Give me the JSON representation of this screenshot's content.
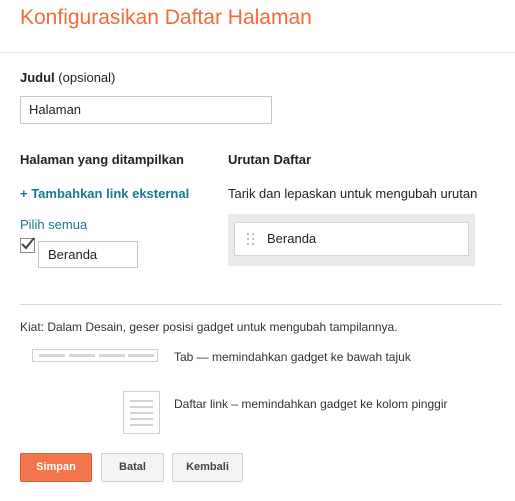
{
  "header": {
    "title": "Konfigurasikan Daftar Halaman"
  },
  "title_field": {
    "label": "Judul",
    "optional_note": "(opsional)",
    "value": "Halaman"
  },
  "pages_section": {
    "heading": "Halaman yang ditampilkan",
    "add_link": "+ Tambahkan link eksternal",
    "select_all": "Pilih semua",
    "pages": [
      {
        "label": "Beranda",
        "checked": true
      }
    ]
  },
  "order_section": {
    "heading": "Urutan Daftar",
    "description": "Tarik dan lepaskan untuk mengubah urutan",
    "items": [
      {
        "label": "Beranda",
        "icon": "drag-handle-icon"
      }
    ]
  },
  "tips": {
    "text": "Kiat: Dalam Desain, geser posisi gadget untuk mengubah tampilannya.",
    "options": [
      {
        "icon": "tab-layout-icon",
        "text": "Tab — memindahkan gadget ke bawah tajuk"
      },
      {
        "icon": "link-list-layout-icon",
        "text": "Daftar link – memindahkan gadget ke kolom pinggir"
      }
    ]
  },
  "actions": {
    "save": "Simpan",
    "cancel": "Batal",
    "back": "Kembali"
  },
  "colors": {
    "accent": "#f16a3c",
    "link": "#1c7b8a",
    "primary_button": "#f2754b"
  }
}
